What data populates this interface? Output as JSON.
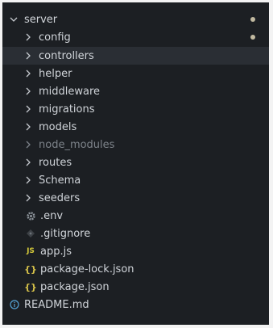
{
  "explorer": {
    "root_folder": {
      "label": "server",
      "modified": true
    },
    "folders": [
      {
        "label": "config",
        "modified": true,
        "dim": false,
        "selected": false
      },
      {
        "label": "controllers",
        "modified": false,
        "dim": false,
        "selected": true
      },
      {
        "label": "helper",
        "modified": false,
        "dim": false,
        "selected": false
      },
      {
        "label": "middleware",
        "modified": false,
        "dim": false,
        "selected": false
      },
      {
        "label": "migrations",
        "modified": false,
        "dim": false,
        "selected": false
      },
      {
        "label": "models",
        "modified": false,
        "dim": false,
        "selected": false
      },
      {
        "label": "node_modules",
        "modified": false,
        "dim": true,
        "selected": false
      },
      {
        "label": "routes",
        "modified": false,
        "dim": false,
        "selected": false
      },
      {
        "label": "Schema",
        "modified": false,
        "dim": false,
        "selected": false
      },
      {
        "label": "seeders",
        "modified": false,
        "dim": false,
        "selected": false
      }
    ],
    "files": [
      {
        "label": ".env",
        "icon": "gear-icon"
      },
      {
        "label": ".gitignore",
        "icon": "git-diamond-icon"
      },
      {
        "label": "app.js",
        "icon": "js-icon",
        "icon_text": "JS"
      },
      {
        "label": "package-lock.json",
        "icon": "json-braces-icon",
        "icon_text": "{}"
      },
      {
        "label": "package.json",
        "icon": "json-braces-icon",
        "icon_text": "{}"
      }
    ],
    "root_files": [
      {
        "label": "README.md",
        "icon": "info-icon"
      }
    ]
  },
  "colors": {
    "panel_bg": "#1c1f23",
    "selected_bg": "#2a2e34",
    "text": "#d0d4d9",
    "dim_text": "#7d838a",
    "modified_dot": "#c1b9a0",
    "js_icon": "#d4c93a",
    "json_icon": "#d9c44a",
    "info_icon": "#55a4d6"
  }
}
